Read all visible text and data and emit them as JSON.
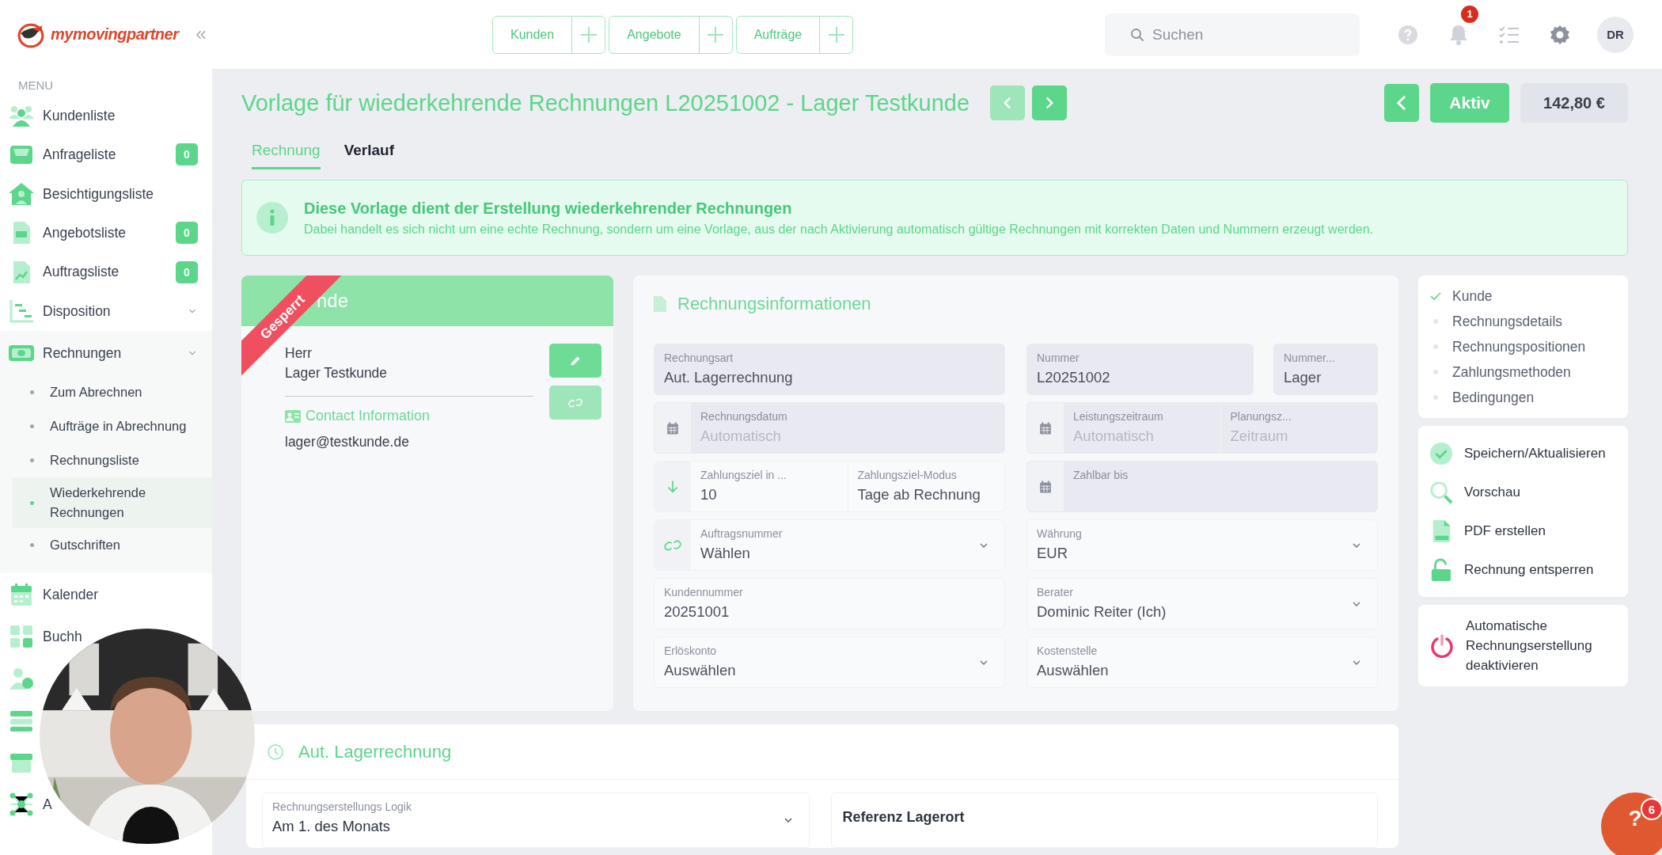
{
  "header": {
    "logo": "mymovingpartner",
    "quick_add": [
      {
        "label": "Kunden"
      },
      {
        "label": "Angebote"
      },
      {
        "label": "Aufträge"
      }
    ],
    "search": {
      "placeholder": "Suchen"
    },
    "notifications": {
      "badge": "1"
    },
    "avatar": "DR"
  },
  "sidebar": {
    "heading": "MENU",
    "items": [
      {
        "label": "Kundenliste"
      },
      {
        "label": "Anfrageliste",
        "badge": "0"
      },
      {
        "label": "Besichtigungsliste"
      },
      {
        "label": "Angebotsliste",
        "badge": "0"
      },
      {
        "label": "Auftragsliste",
        "badge": "0"
      },
      {
        "label": "Disposition",
        "expanded": false
      },
      {
        "label": "Rechnungen",
        "expanded": true,
        "children": [
          {
            "label": "Zum Abrechnen",
            "selected": false
          },
          {
            "label": "Aufträge in Abrechnung",
            "selected": false
          },
          {
            "label": "Rechnungsliste",
            "selected": false
          },
          {
            "label": "Wiederkehrende Rechnungen",
            "selected": true
          },
          {
            "label": "Gutschriften",
            "selected": false
          }
        ]
      },
      {
        "label": "Kalender"
      },
      {
        "label": "Buchh"
      },
      {
        "kind": "icon_only"
      },
      {
        "kind": "icon_only"
      },
      {
        "kind": "icon_only"
      },
      {
        "label": "A"
      }
    ]
  },
  "title_bar": {
    "title": "Vorlage für wiederkehrende Rechnungen L20251002 - Lager Testkunde",
    "nav": [
      {
        "disabled": true
      },
      {
        "disabled": false
      }
    ],
    "status": "Aktiv",
    "amount": "142,80 €"
  },
  "tabs": [
    {
      "label": "Rechnung",
      "selected": true
    },
    {
      "label": "Verlauf",
      "selected": false
    }
  ],
  "banner": {
    "title": "Diese Vorlage dient der Erstellung wiederkehrender Rechnungen",
    "text": "Dabei handelt es sich nicht um eine echte Rechnung, sondern um eine Vorlage, aus der nach Aktivierung automatisch gültige Rechnungen mit korrekten Daten und Nummern erzeugt werden."
  },
  "customer_card": {
    "header": "nde",
    "ribbon": "Gesperrt",
    "salutation": "Herr",
    "name": "Lager Testkunde",
    "contact_heading": "Contact Information",
    "email": "lager@testkunde.de",
    "actions": [
      {
        "disabled": false
      },
      {
        "disabled": true
      }
    ]
  },
  "invoice_info": {
    "title": "Rechnungsinformationen",
    "columns": [
      [
        [
          {
            "kind": "text",
            "shaded": true,
            "dropdown": false,
            "parts": [
              {
                "label": "Rechnungsart",
                "value": "Aut. Lagerrechnung"
              }
            ]
          }
        ],
        [
          {
            "kind": "date",
            "shaded": true,
            "dropdown": false,
            "parts": [
              {
                "label": "Rechnungsdatum",
                "placeholder": "Automatisch"
              }
            ]
          }
        ],
        [
          {
            "kind": "number",
            "shaded": false,
            "dropdown": false,
            "parts": [
              {
                "label": "Zahlungsziel in ...",
                "value": "10"
              },
              {
                "label": "Zahlungsziel-Modus",
                "value": "Tage ab Rechnung"
              }
            ]
          }
        ],
        [
          {
            "kind": "reference",
            "shaded": false,
            "dropdown": true,
            "parts": [
              {
                "label": "Auftragsnummer",
                "value": "Wählen"
              }
            ]
          }
        ],
        [
          {
            "kind": "text",
            "shaded": false,
            "dropdown": false,
            "parts": [
              {
                "label": "Kundennummer",
                "value": "20251001"
              }
            ]
          }
        ],
        [
          {
            "kind": "text",
            "shaded": false,
            "dropdown": true,
            "parts": [
              {
                "label": "Erlöskonto",
                "value": "Auswählen"
              }
            ]
          }
        ]
      ],
      [
        [
          {
            "kind": "text",
            "shaded": true,
            "dropdown": false,
            "parts": [
              {
                "label": "Nummer",
                "value": "L20251002"
              }
            ]
          },
          {
            "kind": "text",
            "shaded": true,
            "dropdown": false,
            "parts": [
              {
                "label": "Nummer...",
                "value": "Lager"
              }
            ]
          }
        ],
        [
          {
            "kind": "date",
            "shaded": true,
            "dropdown": false,
            "parts": [
              {
                "label": "Leistungszeitraum",
                "placeholder": "Automatisch"
              },
              {
                "label": "Planungsz...",
                "placeholder": "Zeitraum"
              }
            ]
          }
        ],
        [
          {
            "kind": "date",
            "shaded": true,
            "dropdown": false,
            "parts": [
              {
                "label": "Zahlbar bis"
              }
            ]
          }
        ],
        [
          {
            "kind": "text",
            "shaded": false,
            "dropdown": true,
            "parts": [
              {
                "label": "Währung",
                "value": "EUR"
              }
            ]
          }
        ],
        [
          {
            "kind": "text",
            "shaded": false,
            "dropdown": true,
            "parts": [
              {
                "label": "Berater",
                "value": "Dominic Reiter (Ich)"
              }
            ]
          }
        ],
        [
          {
            "kind": "text",
            "shaded": false,
            "dropdown": true,
            "parts": [
              {
                "label": "Kostenstelle",
                "value": "Auswählen"
              }
            ]
          }
        ]
      ]
    ]
  },
  "steps": [
    {
      "label": "Kunde",
      "done": true
    },
    {
      "label": "Rechnungsdetails",
      "done": false
    },
    {
      "label": "Rechnungspositionen",
      "done": false
    },
    {
      "label": "Zahlungsmethoden",
      "done": false
    },
    {
      "label": "Bedingungen",
      "done": false
    }
  ],
  "actions": [
    {
      "label": "Speichern/Aktualisieren"
    },
    {
      "label": "Vorschau"
    },
    {
      "label": "PDF erstellen"
    },
    {
      "label": "Rechnung entsperren"
    }
  ],
  "deactivate": {
    "label": "Automatische Rechnungserstellung deaktivieren"
  },
  "storage_card": {
    "title": "Aut. Lagerrechnung",
    "fields": [
      {
        "kind": "select",
        "label": "Rechnungserstellungs Logik",
        "value": "Am 1. des Monats"
      },
      {
        "kind": "heading",
        "label": "Referenz Lagerort"
      }
    ]
  },
  "help": {
    "symbol": "?",
    "badge": "6"
  }
}
